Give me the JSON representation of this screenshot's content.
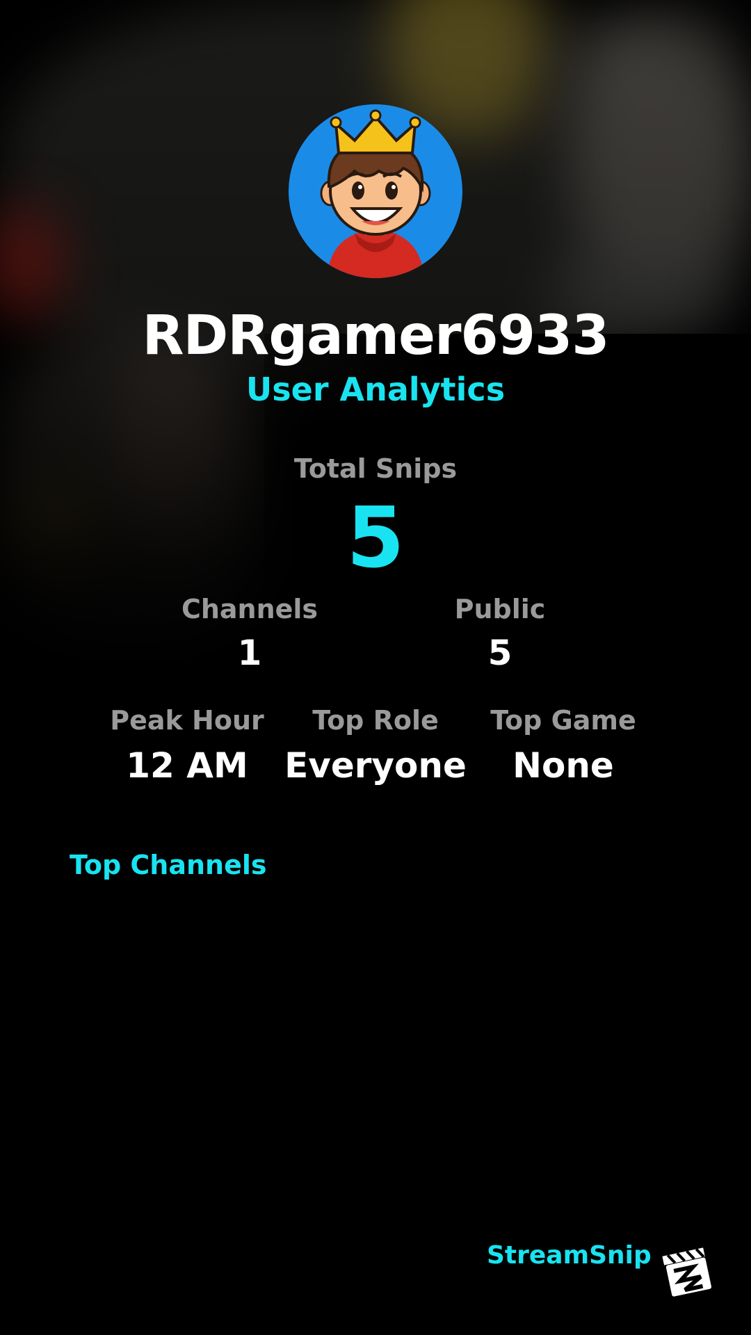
{
  "profile": {
    "username": "RDRgamer6933",
    "subtitle": "User Analytics",
    "avatar_icon": "crowned-boy-avatar-icon"
  },
  "stats": {
    "total_snips_label": "Total Snips",
    "total_snips_value": "5",
    "channels_label": "Channels",
    "channels_value": "1",
    "public_label": "Public",
    "public_value": "5",
    "peak_hour_label": "Peak Hour",
    "peak_hour_value": "12 AM",
    "top_role_label": "Top Role",
    "top_role_value": "Everyone",
    "top_game_label": "Top Game",
    "top_game_value": "None"
  },
  "sections": {
    "top_channels_title": "Top Channels"
  },
  "footer": {
    "brand_name": "StreamSnip",
    "brand_icon": "clapperboard-logo-icon"
  },
  "colors": {
    "accent": "#19e3f0",
    "label": "#9a9a9a",
    "background": "#000000",
    "avatar_bg": "#1a8ce8"
  }
}
